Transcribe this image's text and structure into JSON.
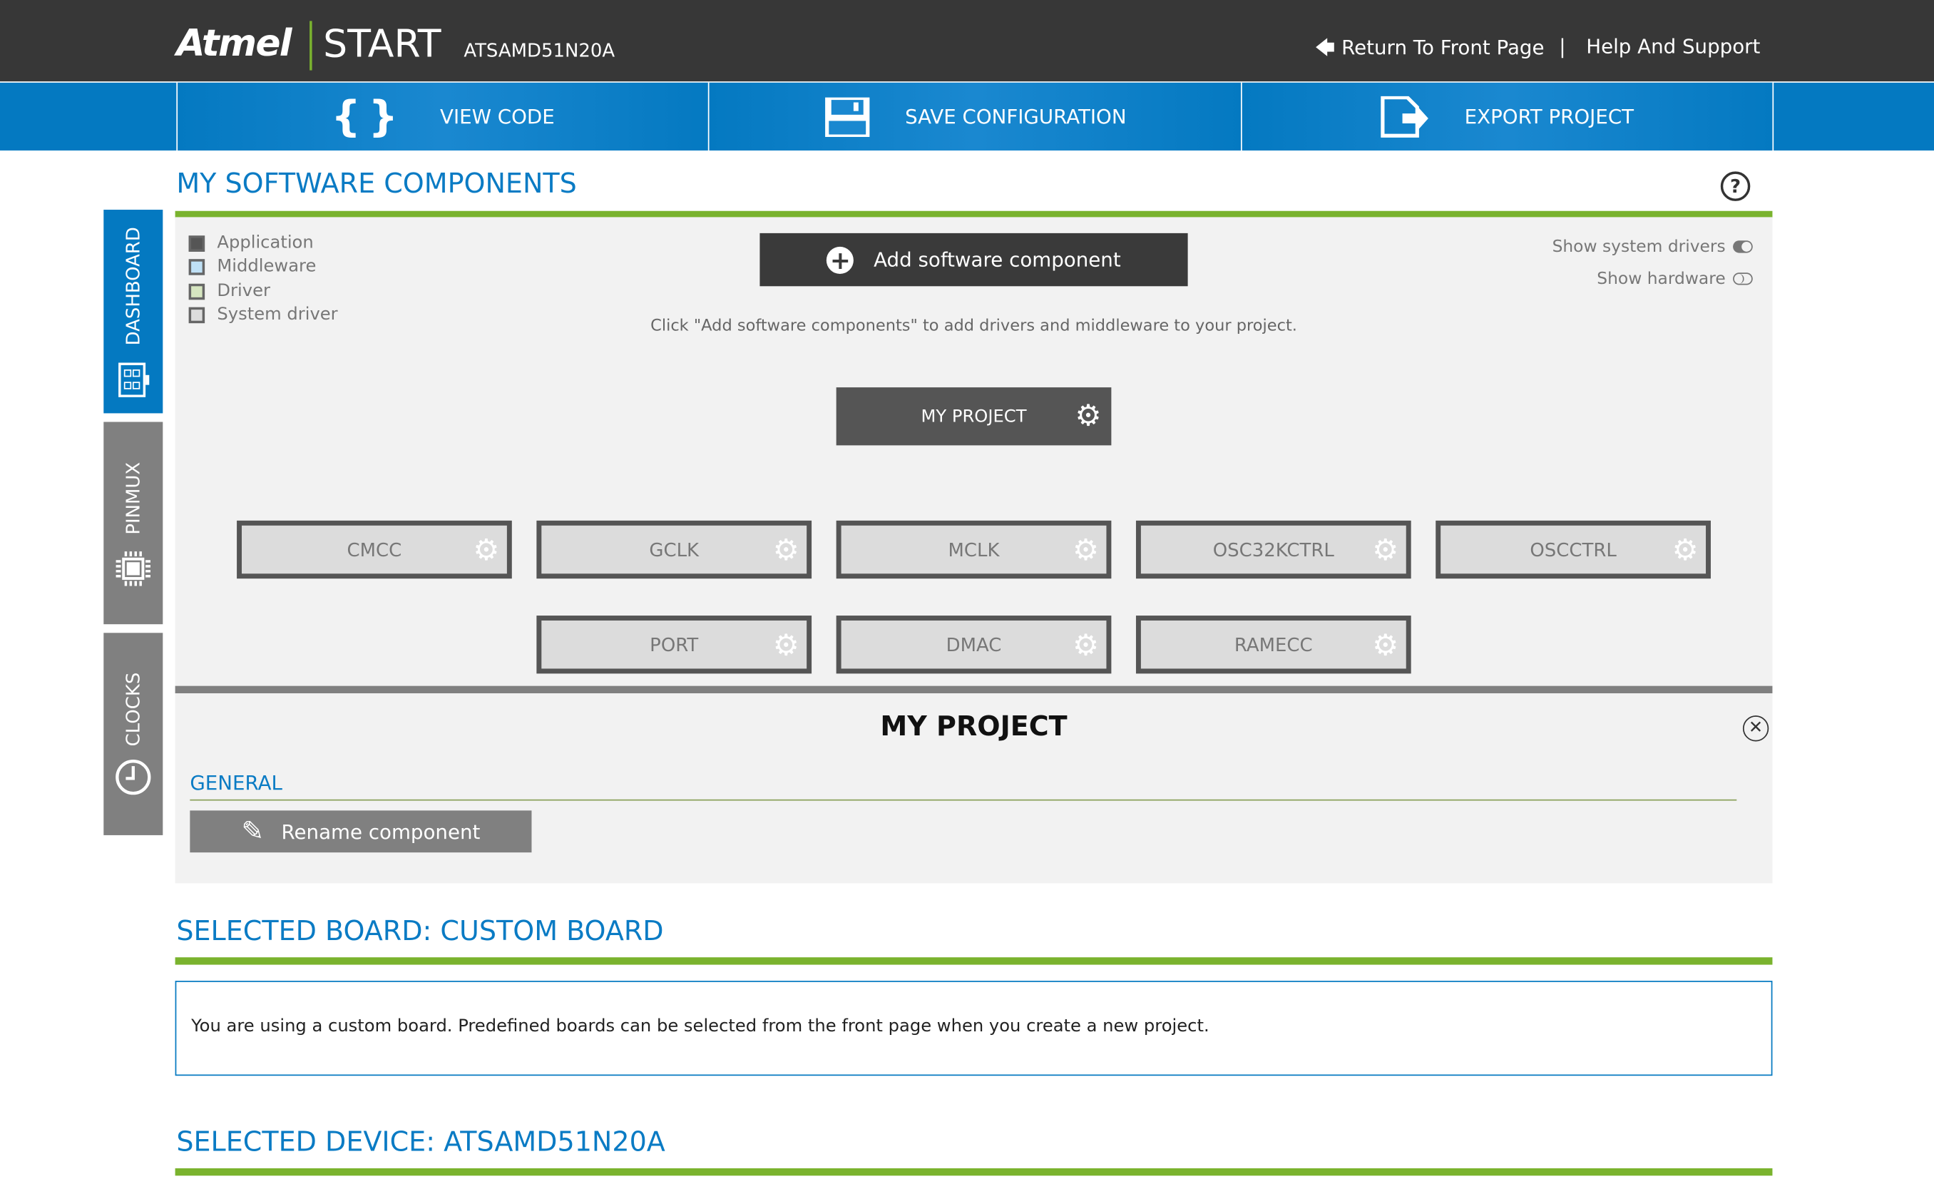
{
  "header": {
    "logo": "Atmel",
    "product": "START",
    "device": "ATSAMD51N20A",
    "return_link": "Return To Front Page",
    "separator": "|",
    "help_link": "Help And Support"
  },
  "toolbar": {
    "view_code": "VIEW CODE",
    "save_configuration": "SAVE CONFIGURATION",
    "export_project": "EXPORT PROJECT"
  },
  "sidebar": {
    "items": [
      {
        "label": "DASHBOARD",
        "icon": "dashboard-icon",
        "active": true
      },
      {
        "label": "PINMUX",
        "icon": "chip-icon",
        "active": false
      },
      {
        "label": "CLOCKS",
        "icon": "clock-icon",
        "active": false
      }
    ]
  },
  "software": {
    "title": "MY SOFTWARE COMPONENTS",
    "legend": [
      {
        "label": "Application",
        "color": "#555555"
      },
      {
        "label": "Middleware",
        "color": "#bfe0f5"
      },
      {
        "label": "Driver",
        "color": "#d6e6c0"
      },
      {
        "label": "System driver",
        "color": "#dcdcdc"
      }
    ],
    "add_button": "Add software component",
    "hint": "Click \"Add software components\" to add drivers and middleware to your project.",
    "show_system_drivers": {
      "label": "Show system drivers",
      "on": true
    },
    "show_hardware": {
      "label": "Show hardware",
      "on": false
    },
    "project": "MY PROJECT",
    "components_row1": [
      "CMCC",
      "GCLK",
      "MCLK",
      "OSC32KCTRL",
      "OSCCTRL"
    ],
    "components_row2": [
      "PORT",
      "DMAC",
      "RAMECC"
    ]
  },
  "details": {
    "title": "MY PROJECT",
    "section": "GENERAL",
    "rename_button": "Rename component"
  },
  "board": {
    "title": "SELECTED BOARD: CUSTOM BOARD",
    "text": "You are using a custom board. Predefined boards can be selected from the front page when you create a new project."
  },
  "device_section": {
    "title": "SELECTED DEVICE: ATSAMD51N20A"
  },
  "colors": {
    "header": "#373737",
    "accent_blue": "#0479c1",
    "accent_green": "#7ab32e"
  }
}
